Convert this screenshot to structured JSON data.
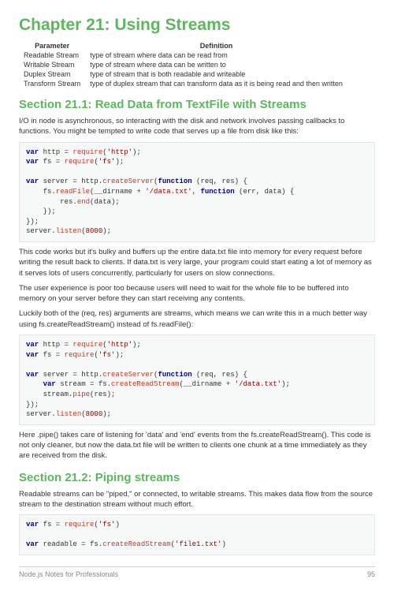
{
  "chapter_title": "Chapter 21: Using Streams",
  "table": {
    "headers": [
      "Parameter",
      "Definition"
    ],
    "rows": [
      [
        "Readable Stream",
        "type of stream where data can be read from"
      ],
      [
        "Writable Stream",
        "type of stream where data can be written to"
      ],
      [
        "Duplex Stream",
        "type of stream that is both readable and writeable"
      ],
      [
        "Transform Stream",
        "type of duplex stream that can transform data as it is being read and then written"
      ]
    ]
  },
  "section1_title": "Section 21.1: Read Data from TextFile with Streams",
  "p1": "I/O in node is asynchronous, so interacting with the disk and network involves passing callbacks to functions. You might be tempted to write code that serves up a file from disk like this:",
  "p2": "This code works but it's bulky and buffers up the entire data.txt file into memory for every request before writing the result back to clients. If data.txt is very large, your program could start eating a lot of memory as it serves lots of users concurrently, particularly for users on slow connections.",
  "p3": "The user experience is poor too because users will need to wait for the whole file to be buffered into memory on your server before they can start receiving any contents.",
  "p4": "Luckily both of the (req, res) arguments are streams, which means we can write this in a much better way using fs.createReadStream() instead of fs.readFile():",
  "p5": "Here .pipe() takes care of listening for 'data' and 'end' events from the fs.createReadStream(). This code is not only cleaner, but now the data.txt file will be written to clients one chunk at a time immediately as they are received from the disk.",
  "section2_title": "Section 21.2: Piping streams",
  "p6": "Readable streams can be \"piped,\" or connected, to writable streams. This makes data flow from the source stream to the destination stream without much effort.",
  "footer_left": "Node.js Notes for Professionals",
  "footer_right": "95"
}
